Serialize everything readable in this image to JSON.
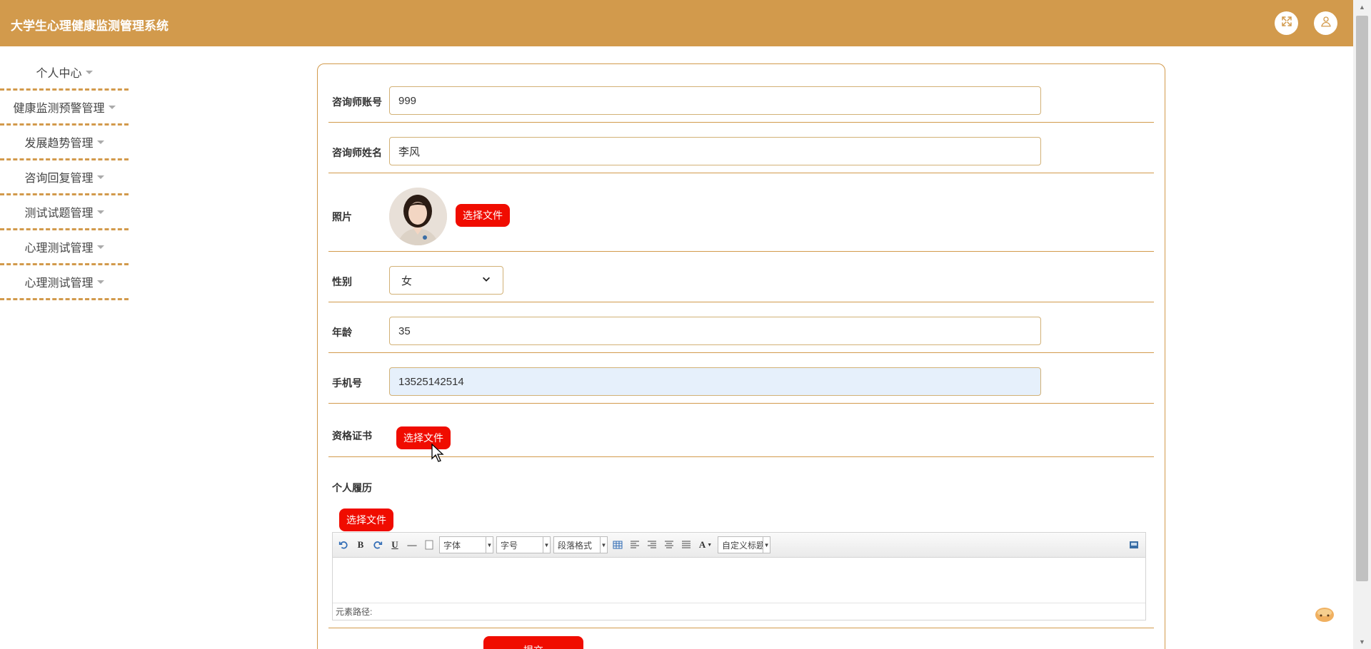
{
  "header": {
    "title": "大学生心理健康监测管理系统",
    "expand_icon": "expand-icon",
    "user_icon": "user-icon",
    "background": "#d29a4c"
  },
  "sidebar": {
    "items": [
      {
        "label": "个人中心"
      },
      {
        "label": "健康监测预警管理"
      },
      {
        "label": "发展趋势管理"
      },
      {
        "label": "咨询回复管理"
      },
      {
        "label": "测试试题管理"
      },
      {
        "label": "心理测试管理"
      },
      {
        "label": "心理测试管理"
      }
    ]
  },
  "form": {
    "account": {
      "label": "咨询师账号",
      "value": "999"
    },
    "name": {
      "label": "咨询师姓名",
      "value": "李风"
    },
    "photo": {
      "label": "照片",
      "button": "选择文件"
    },
    "gender": {
      "label": "性别",
      "value": "女"
    },
    "age": {
      "label": "年龄",
      "value": "35"
    },
    "phone": {
      "label": "手机号",
      "value": "13525142514"
    },
    "certificate": {
      "label": "资格证书",
      "button": "选择文件"
    },
    "resume": {
      "label": "个人履历",
      "button": "选择文件"
    },
    "submit_label": "提交"
  },
  "editor": {
    "font_family": "字体",
    "font_size": "字号",
    "paragraph": "段落格式",
    "custom_title": "自定义标题",
    "path_label": "元素路径:"
  },
  "colors": {
    "accent": "#d29a4c",
    "button": "#f00c00"
  }
}
